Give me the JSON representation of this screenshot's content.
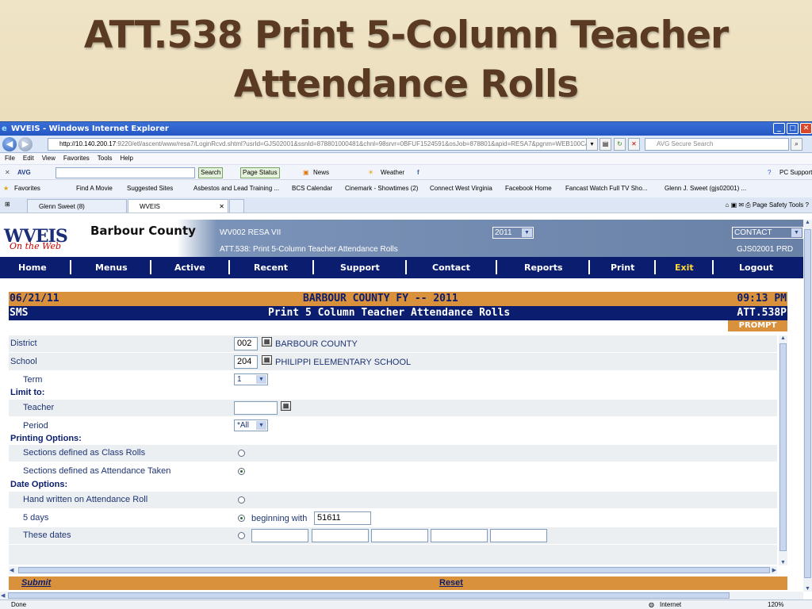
{
  "slide": {
    "title_line1": "ATT.538 Print 5-Column Teacher",
    "title_line2": "Attendance Rolls"
  },
  "window": {
    "title": "WVEIS - Windows Internet Explorer"
  },
  "address": {
    "host": "http://10.140.200.17",
    "rest": ":9220/etl/ascent/www/resa7/LoginRcvd.shtml?usrId=GJS02001&ssnId=878801000481&chnl=98srvr=0BFUF1524591&osJob=878801&apid=RESA7&pgnm=WEB100C&dor",
    "search_placeholder": "AVG Secure Search"
  },
  "menu": [
    "File",
    "Edit",
    "View",
    "Favorites",
    "Tools",
    "Help"
  ],
  "avg": {
    "logo": "AVG",
    "search": "Search",
    "page_status": "Page Status",
    "news": "News",
    "weather": "Weather",
    "pc_support": "PC Support"
  },
  "favorites": [
    "Favorites",
    "Find A Movie",
    "Suggested Sites",
    "Asbestos and Lead Training ...",
    "BCS Calendar",
    "Cinemark - Showtimes (2)",
    "Connect West Virginia",
    "Facebook Home",
    "Fancast  Watch Full TV Sho...",
    "Glenn J. Sweet (gjs02001) ..."
  ],
  "tabs": [
    {
      "label": "Glenn Sweet (8)"
    },
    {
      "label": "WVEIS"
    }
  ],
  "tab_tools": [
    "Page",
    "Safety",
    "Tools"
  ],
  "wveis": {
    "logo": "WVEIS",
    "logo_sub": "On the Web",
    "county": "Barbour County",
    "org": "WV002 RESA VII",
    "screen": "ATT.538: Print 5-Column Teacher Attendance Rolls",
    "year": "2011",
    "contact": "CONTACT",
    "user": "GJS02001 PRD",
    "nav": [
      "Home",
      "Menus",
      "Active",
      "Recent",
      "Support",
      "Contact",
      "Reports",
      "Print",
      "Exit",
      "Logout"
    ]
  },
  "report": {
    "date": "06/21/11",
    "title": "BARBOUR COUNTY FY -- 2011",
    "time": "09:13 PM",
    "module": "SMS",
    "subtitle": "Print 5 Column Teacher Attendance Rolls",
    "code": "ATT.538P",
    "prompt": "PROMPT"
  },
  "form": {
    "district_label": "District",
    "district_code": "002",
    "district_name": "BARBOUR COUNTY",
    "school_label": "School",
    "school_code": "204",
    "school_name": "PHILIPPI ELEMENTARY SCHOOL",
    "term_label": "Term",
    "term_value": "1",
    "limit_label": "Limit to:",
    "teacher_label": "Teacher",
    "teacher_value": "",
    "period_label": "Period",
    "period_value": "*All",
    "printing_label": "Printing Options:",
    "class_rolls_label": "Sections defined as Class Rolls",
    "attendance_taken_label": "Sections defined as Attendance Taken",
    "date_label": "Date Options:",
    "handwritten_label": "Hand written on Attendance Roll",
    "five_days_label": "5 days",
    "beginning_label": "beginning with",
    "beginning_value": "51611",
    "these_dates_label": "These dates"
  },
  "footer": {
    "submit": "Submit",
    "reset": "Reset"
  },
  "status": {
    "text": "Done",
    "zone": "Internet",
    "zoom": "120%"
  }
}
